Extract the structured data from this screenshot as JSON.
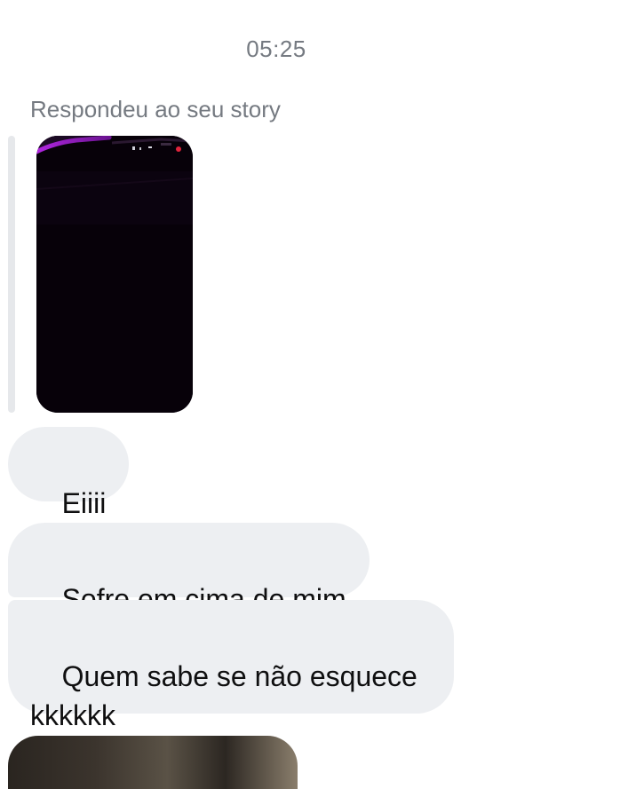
{
  "chat": {
    "timestamp": "05:25",
    "reply_label": "Respondeu ao seu story",
    "messages": [
      {
        "text": "Eiiii"
      },
      {
        "text": "Sofre em cima de mim"
      },
      {
        "text": "Quem sabe se não esquece\nkkkkkk"
      }
    ]
  },
  "colors": {
    "bubble_background": "#edeff2",
    "meta_text": "#757a81",
    "message_text": "#0f0f10",
    "reply_bar": "#e6e8eb",
    "story_accent": "#a020c8"
  }
}
